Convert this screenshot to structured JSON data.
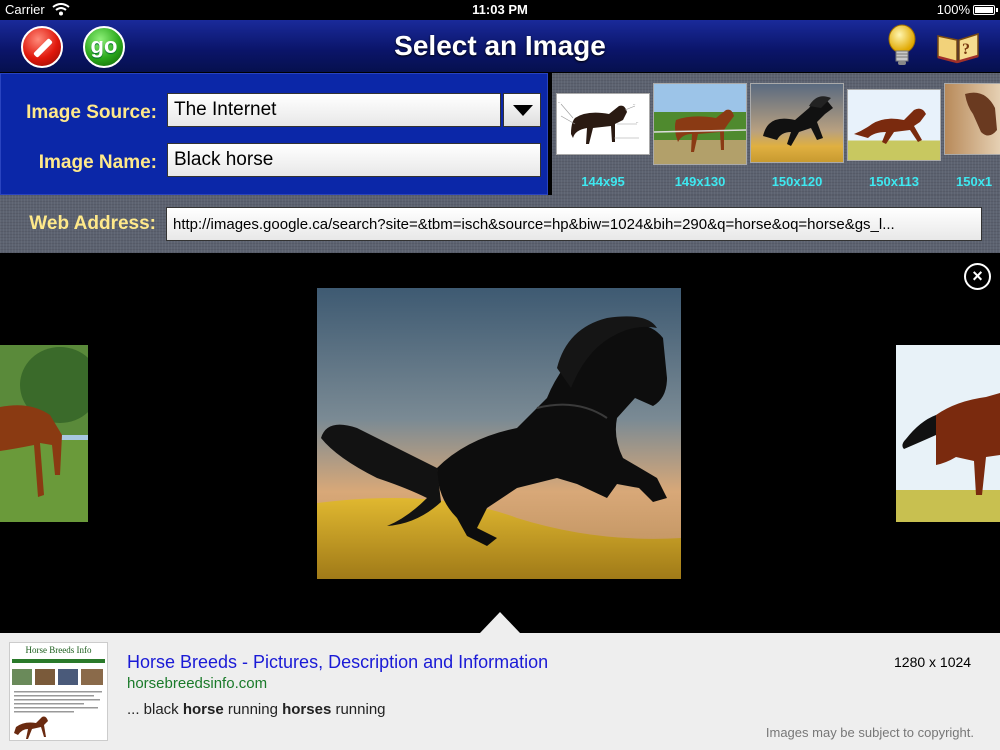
{
  "status": {
    "carrier": "Carrier",
    "time": "11:03 PM",
    "battery": "100%"
  },
  "titlebar": {
    "title": "Select an Image",
    "go_label": "go"
  },
  "form": {
    "source_label": "Image Source:",
    "source_value": "The Internet",
    "name_label": "Image Name:",
    "name_value": "Black horse",
    "web_label": "Web Address:",
    "web_value": "http://images.google.ca/search?site=&tbm=isch&source=hp&biw=1024&bih=290&q=horse&oq=horse&gs_l..."
  },
  "thumbnails": [
    {
      "size": "144x95"
    },
    {
      "size": "149x130"
    },
    {
      "size": "150x120"
    },
    {
      "size": "150x113"
    },
    {
      "size": "150x1"
    }
  ],
  "viewer": {
    "close_glyph": "×"
  },
  "result": {
    "site_thumb_title": "Horse Breeds Info",
    "title": "Horse Breeds - Pictures, Description and Information",
    "url": "horsebreedsinfo.com",
    "snippet_parts": [
      "... black ",
      "horse",
      " running ",
      "horses",
      " running"
    ],
    "dimensions": "1280 x 1024",
    "copyright": "Images may be subject to copyright."
  },
  "colors": {
    "accent_blue": "#0b27a8",
    "label_yellow": "#ffe98a",
    "size_cyan": "#3ee8f0",
    "link_blue": "#1a1ad6",
    "url_green": "#1a7a2a"
  },
  "icons": [
    "wifi-icon",
    "battery-icon",
    "edit-icon",
    "go-button",
    "lightbulb-icon",
    "book-icon",
    "dropdown-arrow-icon",
    "close-icon"
  ]
}
